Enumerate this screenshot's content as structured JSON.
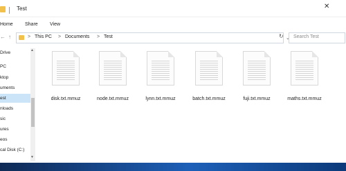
{
  "window": {
    "title": "Test",
    "close_glyph": "✕"
  },
  "ribbon": {
    "tabs": [
      "Home",
      "Share",
      "View"
    ]
  },
  "nav_buttons": {
    "back": "←",
    "up": "↑",
    "chevron": "›"
  },
  "address": {
    "segments": [
      "This PC",
      "Documents",
      "Test"
    ],
    "separator": ">",
    "dropdown": "⌄",
    "refresh": "↻"
  },
  "search": {
    "placeholder": "Search Test"
  },
  "sidebar": {
    "items": [
      {
        "label": "Drive",
        "selected": false
      },
      {
        "label": "PC",
        "selected": false
      },
      {
        "label": "ktop",
        "selected": false
      },
      {
        "label": "uments",
        "selected": false
      },
      {
        "label": "est",
        "selected": true
      },
      {
        "label": "nloads",
        "selected": false
      },
      {
        "label": "sic",
        "selected": false
      },
      {
        "label": "ures",
        "selected": false
      },
      {
        "label": "eos",
        "selected": false
      },
      {
        "label": "cal Disk (C:)",
        "selected": false
      }
    ]
  },
  "files": [
    {
      "name": "disk.txt.mmuz"
    },
    {
      "name": "node.txt.mmuz"
    },
    {
      "name": "lynn.txt.mmuz"
    },
    {
      "name": "batch.txt.mmuz"
    },
    {
      "name": "fuji.txt.mmuz"
    },
    {
      "name": "maths.txt.mmuz"
    }
  ],
  "colors": {
    "folder": "#f2c14b",
    "selection": "#cce4f7",
    "taskbar": "#1d5fb8"
  }
}
